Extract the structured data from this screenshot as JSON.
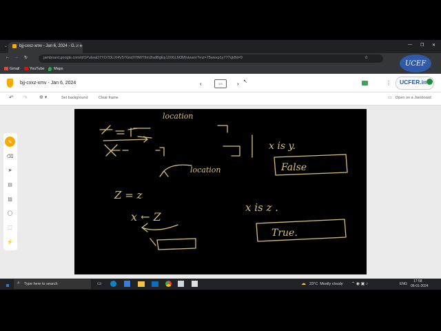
{
  "browser": {
    "tab_title": "bjj-cxxz-xmv - Jan 6, 2024 - G...",
    "url": "jamboard.google.com/d/1PulwaD7YO7DLlX4V57Gis0Y8WT9m2lsdBgEp1lXKiLM3M/viewer?mz=75wexp1y777qk8d=9",
    "bookmarks": [
      "Gmail",
      "YouTube",
      "Maps"
    ],
    "window_controls": [
      "minimize",
      "maximize",
      "close"
    ]
  },
  "app": {
    "title": "bjj-cxxz-xmv - Jan 6, 2024",
    "toolbar": {
      "set_background": "Set background",
      "clear_frame": "Clear frame",
      "open_on_jamboard": "Open on a Jamboard"
    },
    "frame_indicator": "2/3",
    "side_tools": [
      "pen-icon",
      "eraser-icon",
      "select-icon",
      "sticky-note-icon",
      "image-icon",
      "shape-icon",
      "textbox-icon",
      "laser-icon"
    ]
  },
  "board": {
    "notes": {
      "location_top": "location",
      "location_bottom": "location",
      "x_is_y": "x is y.",
      "false_box": "False",
      "z_eq_z": "Z = z",
      "x_is_z": "x is z .",
      "true_box": "True.",
      "x_arrow_z": "x ← Z"
    }
  },
  "watermark": {
    "logo_text": "UCEF",
    "badge_text": "UCFER.in"
  },
  "taskbar": {
    "search_placeholder": "Type here to search",
    "weather": "23°C  Mostly cloudy",
    "time": "17:58",
    "date": "06-01-2024",
    "lang": "ENG"
  },
  "colors": {
    "ink": "#d9c27a",
    "pen_active": "#f9ab00",
    "brand": "#1a56a8"
  }
}
